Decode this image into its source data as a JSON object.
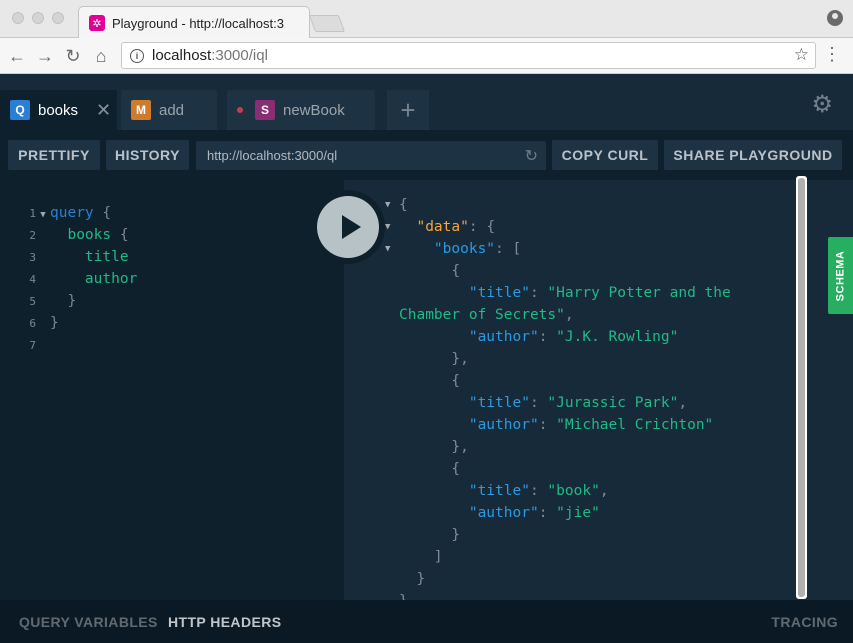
{
  "browser": {
    "tab_title": "Playground - http://localhost:3",
    "url_host": "localhost",
    "url_rest": ":3000/iql"
  },
  "playground": {
    "tabs": [
      {
        "badge": "Q",
        "label": "books",
        "badge_color": "#2a7ed3"
      },
      {
        "badge": "M",
        "label": "add",
        "badge_color": "#cf7b2c"
      },
      {
        "badge": "S",
        "label": "newBook",
        "badge_color": "#8b2d72"
      }
    ],
    "toolbar": {
      "prettify": "PRETTIFY",
      "history": "HISTORY",
      "endpoint": "http://localhost:3000/ql",
      "copy_curl": "COPY CURL",
      "share": "SHARE PLAYGROUND"
    },
    "editor": {
      "line_numbers": [
        "1",
        "2",
        "3",
        "4",
        "5",
        "6",
        "7"
      ],
      "lines": [
        {
          "keyword": "query",
          "punct": " {"
        },
        {
          "field": "books",
          "punct": " {"
        },
        {
          "field": "title"
        },
        {
          "field": "author"
        },
        {
          "punct": "}"
        },
        {
          "punct": "}"
        },
        {}
      ]
    },
    "result": {
      "brace_open": "{",
      "data_key": "\"data\"",
      "books_key": "\"books\"",
      "title_key": "\"title\"",
      "author_key": "\"author\"",
      "books": [
        {
          "title_part1": "\"Harry Potter and the",
          "title_part2": "Chamber of Secrets\"",
          "author": "\"J.K. Rowling\""
        },
        {
          "title": "\"Jurassic Park\"",
          "author": "\"Michael Crichton\""
        },
        {
          "title": "\"book\"",
          "author": "\"jie\""
        }
      ]
    },
    "schema_label": "SCHEMA",
    "bottom": {
      "query_variables": "QUERY VARIABLES",
      "http_headers": "HTTP HEADERS",
      "tracing": "TRACING"
    }
  },
  "colors": {
    "background": "#0f202d",
    "result_background": "#172a3a",
    "schema_green": "#27ae60",
    "favicon_pink": "#e10098"
  }
}
